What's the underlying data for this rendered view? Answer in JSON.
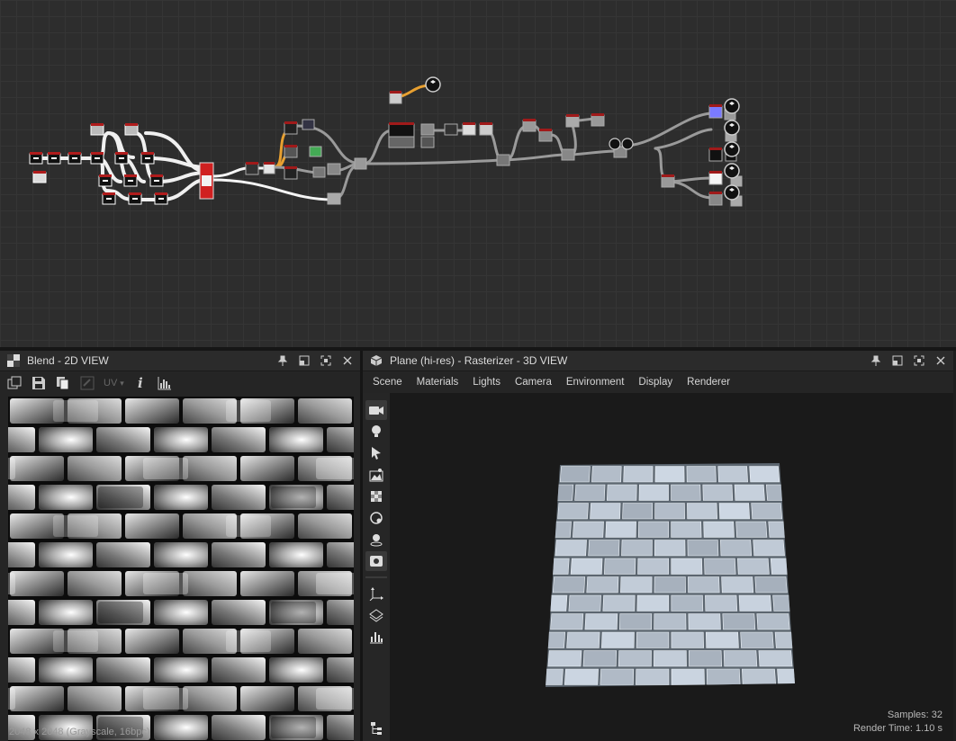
{
  "panel2d": {
    "title": "Blend - 2D VIEW",
    "uv_label": "UV",
    "status_text": "2048 x 2048 (Grayscale, 16bpc)"
  },
  "panel3d": {
    "title": "Plane (hi-res) - Rasterizer - 3D VIEW",
    "menus": [
      "Scene",
      "Materials",
      "Lights",
      "Camera",
      "Environment",
      "Display",
      "Renderer"
    ],
    "samples_text": "Samples: 32",
    "render_time_text": "Render Time: 1.10 s"
  },
  "icons": {
    "title_2d": "checker-icon",
    "title_3d": "cube-icon",
    "window_buttons": [
      "pin-icon",
      "restore-icon",
      "maximize-icon",
      "close-icon"
    ],
    "toolbar_2d": [
      "export-icon",
      "save-icon",
      "copy-icon",
      "compare-icon",
      "info-icon",
      "histogram-icon"
    ],
    "sidebar_3d": [
      "camera-icon",
      "light-bulb-icon",
      "cursor-icon",
      "environment-icon",
      "material-icon",
      "sphere-icon",
      "lighting-icon",
      "settings-icon",
      "axes-icon",
      "layers-icon",
      "stats-icon",
      "hierarchy-icon"
    ]
  },
  "colors": {
    "graph_background": "#2d2d2d",
    "panel_background": "#252525",
    "viewport_background": "#1a1a1a",
    "node_header_red": "#a01a1a",
    "selected_wire": "#e8a030",
    "output_blue": "#7a7aff"
  }
}
